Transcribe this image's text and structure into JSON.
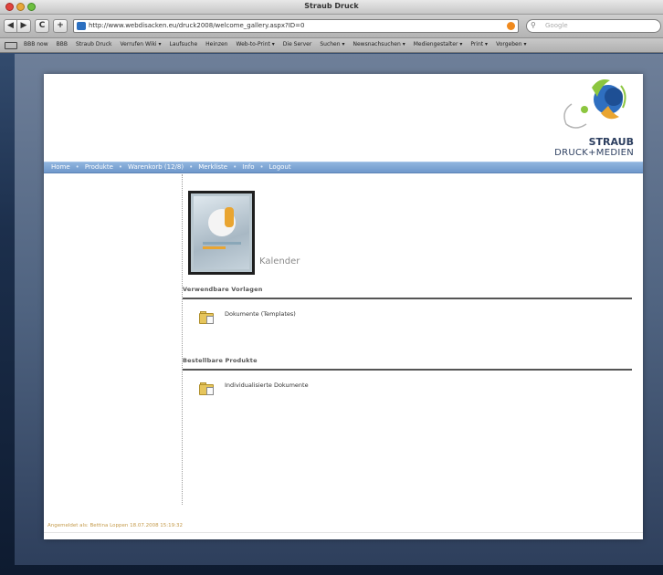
{
  "window": {
    "title": "Straub Druck",
    "url": "http://www.webdisacken.eu/druck2008/welcome_gallery.aspx?ID=0",
    "search_placeholder": "Google"
  },
  "toolbar": {
    "back_label": "◀",
    "forward_label": "▶",
    "reload_label": "C",
    "add_label": "+"
  },
  "bookmarks": [
    "BBB now",
    "BBB",
    "Straub Druck",
    "Verrufen Wiki ▾",
    "Laufsuche",
    "Heinzen",
    "Web-to-Print ▾",
    "Die Server",
    "Suchen ▾",
    "Newsnachsuchen ▾",
    "Mediengestalter ▾",
    "Print ▾",
    "Vorgeben ▾"
  ],
  "logo": {
    "main": "STRAUB",
    "sub": "DRUCK+MEDIEN"
  },
  "nav": {
    "items": [
      "Home",
      "Produkte",
      "Warenkorb (12/8)",
      "Merkliste",
      "Info",
      "Logout"
    ]
  },
  "main": {
    "catalog_title": "Kalender",
    "sections": [
      {
        "heading": "Verwendbare Vorlagen",
        "item_label": "Dokumente (Templates)"
      },
      {
        "heading": "Bestellbare Produkte",
        "item_label": "Individualisierte Dokumente"
      }
    ]
  },
  "footer": {
    "text": "Angemeldet als: Bettina Loppen 18.07.2008 15:19:32"
  }
}
